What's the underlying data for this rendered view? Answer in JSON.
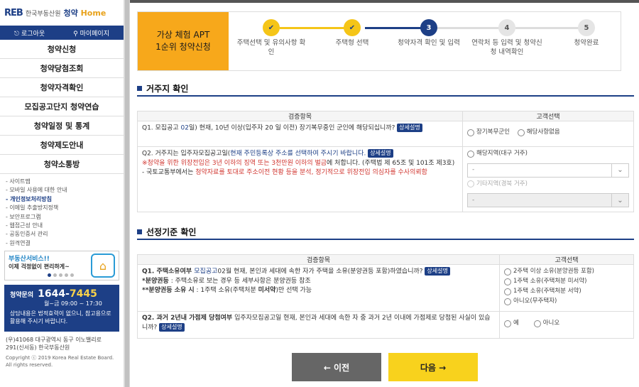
{
  "logo": {
    "reb": "REB",
    "org": "한국부동산원",
    "brand": "청약",
    "brand_home": "Home"
  },
  "auth": {
    "logout": "로그아웃",
    "mypage": "마이페이지"
  },
  "menu": [
    "청약신청",
    "청약당첨조회",
    "청약자격확인",
    "모집공고단지 청약연습",
    "청약일정 및 통계",
    "청약제도안내",
    "청약소통방"
  ],
  "links": [
    "- 사이트맵",
    "- 모바일 사용에 대한 안내",
    "- 개인정보처리방침",
    "- 이메일 추출방지정책",
    "- 보안프로그램",
    "- 웹접근성 안내",
    "- 공동인증서 관리",
    "- 원격연결"
  ],
  "banner": {
    "title": "부동산서비스!!",
    "subtitle": "이제 걱정없이 편리하게~"
  },
  "call": {
    "label": "청약문의",
    "num_a": "1644-",
    "num_b": "7445",
    "hours": "월~금 09:00 ~ 17:30",
    "note": "상담내용은 법적효력이 없으니, 참고용으로 활용해 주시기 바랍니다."
  },
  "address": "(우)41068 대구광역시 동구 이노밸리로 291(신서동) 한국부동산원",
  "copyright": "Copyright ⓒ 2019 Korea Real Estate Board. All rights reserved.",
  "steps": {
    "apt_line1": "가상 체험 APT",
    "apt_line2": "1순위 청약신청",
    "items": [
      {
        "num": "✔",
        "label": "주택선택 및 유의사항 확인",
        "state": "done"
      },
      {
        "num": "✔",
        "label": "주택형 선택",
        "state": "done"
      },
      {
        "num": "3",
        "label": "청약자격 확인 및 입력",
        "state": "current"
      },
      {
        "num": "4",
        "label": "연락처 등 입력 및 청약신청 내역확인",
        "state": "todo"
      },
      {
        "num": "5",
        "label": "청약완료",
        "state": "todo"
      }
    ]
  },
  "section1": {
    "title": "거주지 확인",
    "col1": "검증항목",
    "col2": "고객선택",
    "q1": {
      "text_a": "Q1. 모집공고",
      "text_b": " 02",
      "text_c": "일) 현재, 10년 이상(입주자 20",
      "text_d": " 일 이전) 장기복무중인 군인에 해당되십니까?",
      "detail": "상세설명",
      "opt1": "장기복무군인",
      "opt2": "해당사항없음"
    },
    "q2": {
      "text_a": "Q2. 거주지는 입주자모집공고일(",
      "text_b": "현재 주민등록상 주소를 선택하여 주시기 바랍니다.",
      "detail": "상세설명",
      "warn1": "※청약을 위한 위장전입은 3년 이하의 징역 또는 3천만원 이하의 벌금",
      "warn1b": "에 처합니다. (주택법 제 65조 및 101조 제3호)",
      "warn2a": "- 국토교통부에서는 ",
      "warn2b": "청약자료를 토대로 주소이전 현황 등을 분석, 정기적으로 위장전입 의심자를 수사의뢰함",
      "opt1": "해당지역(대구 거주)",
      "sel1": "-",
      "opt2": "기타지역(경북 거주)",
      "sel2": "-"
    }
  },
  "section2": {
    "title": "선정기준 확인",
    "col1": "검증항목",
    "col2": "고객선택",
    "q1": {
      "text_a": "Q1. 주택소유여부 ",
      "text_b": "모집공고",
      "text_c": "02월",
      "text_d": " 현재, 본인과 세대에 속한 자가 주택을 소유(분양권등 포함)하였습니까?",
      "detail": "상세설명",
      "note1a": "*분양권등",
      "note1b": " : 주택소유로 보는 경우 등 세부사항은 분양권등 참조",
      "note2a": "**분양권등 소유 시",
      "note2b": " : 1주택 소유(주택처분 ",
      "note2c": "미서약",
      "note2d": ")만 선택 가능",
      "opts": [
        "2주택 이상 소유(분양권등 포함)",
        "1주택 소유(주택처분 미서약)",
        "1주택 소유(주택처분 서약)",
        "아니오(무주택자)"
      ]
    },
    "q2": {
      "text_a": "Q2. 과거 2년내 가점제 당첨여부",
      "text_b": " 입주자모집공고일 현재, 본인과 세대에 속한 자 중 과거 2년 이내에 가점제로 당첨된 사실이 있습니까?",
      "detail": "상세설명",
      "opt1": "예",
      "opt2": "아니오"
    }
  },
  "buttons": {
    "prev": "← 이전",
    "next": "다음 →"
  },
  "colors": {
    "navy": "#1d3f86",
    "orange": "#f7a81b",
    "yellow": "#f8d21d",
    "gray": "#666666",
    "red": "#d0332d"
  }
}
